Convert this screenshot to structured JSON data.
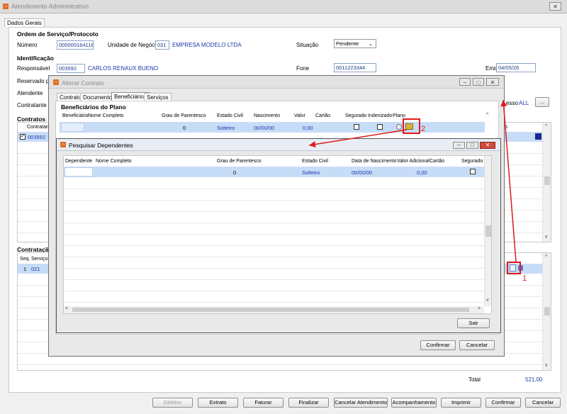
{
  "window": {
    "title": "Atendimento Administrativo",
    "close": "✕"
  },
  "tabs": [
    "Dados Gerais"
  ],
  "ordem": {
    "section": "Ordem de Serviço/Protocolo",
    "numero_label": "Número",
    "numero": "000000164116",
    "unidade_label": "Unidade de Negócio",
    "unidade_code": "031",
    "unidade_name": "EMPRESA MODELO LTDA",
    "situacao_label": "Situação",
    "situacao": "Pendente"
  },
  "identificacao": {
    "section": "Identificação",
    "responsavel_label": "Responsável",
    "responsavel_code": "003592",
    "responsavel_name": "CARLOS RENAUX BUENO",
    "fone_label": "Fone",
    "fone": "0011223344",
    "emissao_label": "Emissão",
    "emissao": "04/05/26",
    "reservado_label": "Reservado po",
    "atendente_label": "Atendente",
    "contratante_label": "Contratante",
    "acesso_label": "esso",
    "acesso_value": "ALL",
    "ellipsis": "..."
  },
  "contratos": {
    "section": "Contratos",
    "col_contratante": "Contratan",
    "col_tail": "o",
    "row_code": "003592"
  },
  "contratacao": {
    "section": "Contrataçã",
    "col_seq": "Seq.",
    "col_servico": "Serviço",
    "row_seq": "1",
    "row_code": "021"
  },
  "total": {
    "label": "Total",
    "value": "521,00"
  },
  "footer_buttons": [
    "Débitos",
    "Extrato",
    "Faturar",
    "Finalizar",
    "Cancelar Atendimento",
    "Acompanhamento",
    "Imprimir",
    "Confirmar",
    "Cancelar"
  ],
  "alterar": {
    "title": "Alterar Contrato",
    "tabs": [
      "Contrato",
      "Documentos",
      "Beneficiários",
      "Serviços"
    ],
    "section": "Beneficiários do Plano",
    "columns": [
      "Beneficiário",
      "Nome Completo",
      "Grau de Parentesco",
      "Estado Civil",
      "Nascimento",
      "Valor",
      "Cartão",
      "Segurado",
      "Indenizado",
      "Plano"
    ],
    "row": {
      "grau": "0",
      "estado": "Solteiro",
      "nascimento": "00/00/00",
      "valor": "0,00"
    },
    "confirm": "Confirmar",
    "cancel": "Cancelar"
  },
  "pesquisar": {
    "title": "Pesquisar Dependentes",
    "columns": [
      "Dependente",
      "Nome Completo",
      "Grau de Parentesco",
      "Estado Civil",
      "Data de Nascimento",
      "Valor Adicional",
      "Cartão",
      "Segurado"
    ],
    "row": {
      "grau": "0",
      "estado": "Solteiro",
      "nascimento": "00/00/00",
      "valor": "0,00"
    },
    "sair": "Sair"
  },
  "annotations": {
    "one": "1",
    "two": "2"
  },
  "colors": {
    "annotation": "#e01a1a",
    "selection": "#c7dcf7",
    "link_text": "#1a3aa8"
  }
}
